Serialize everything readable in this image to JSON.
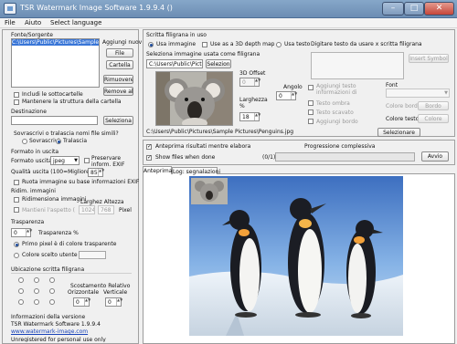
{
  "window": {
    "title": "TSR Watermark Image Software 1.9.9.4 ()",
    "minimize": "–",
    "maximize": "□",
    "close": "✕"
  },
  "menu": [
    "File",
    "Aiuto",
    "Select language"
  ],
  "left": {
    "source": {
      "title": "Fonte/Sorgente",
      "list": [
        "C:\\Users\\Public\\Pictures\\Sample Pictures"
      ],
      "add_label": "Aggiungi nuov",
      "file_btn": "File",
      "folder_btn": "Cartella",
      "remove_btn": "Rimuovere",
      "remove_all_btn": "Remove all",
      "include_subfolders": "Includi le sottocartelle",
      "keep_structure": "Mantenere la struttura della cartella"
    },
    "destination": {
      "title": "Destinazione",
      "value": "",
      "select_btn": "Seleziona"
    },
    "overwrite": {
      "question": "Sovrascrivi o tralascia nomi file simili?",
      "overwrite": "Sovrascrivi",
      "skip": "Tralascia"
    },
    "output": {
      "title": "Formato in uscita",
      "format_label": "Formato uscita",
      "format_value": "jpeg",
      "preserve_exif": "Preservare inform. EXIF",
      "quality_label": "Qualità uscita (100=Migliore)",
      "quality_value": "85",
      "rotate": "Ruota immagine su base informazioni EXIF"
    },
    "resize": {
      "title": "Ridim. immagini",
      "resize_images": "Ridimensiona immagini",
      "width_height": "Larghez Altezza",
      "keep_ratio": "Mantieni l'aspetto (rapp",
      "width": "1024",
      "height": "768",
      "pixel": "Pixel"
    },
    "transparency": {
      "title": "Trasparenza",
      "value": "0",
      "unit": "Trasparenza  %",
      "first_pixel": "Primo pixel è di colore trasparente",
      "user_color": "Colore scelto utente"
    },
    "position": {
      "title": "Ubicazione scritta filigrana",
      "relative_offset": "Scostamento Relativo",
      "horizontal": "Orizzontale",
      "vertical": "Verticale",
      "h_value": "0",
      "v_value": "0"
    },
    "version": {
      "title": "Informazioni della versione",
      "name": "TSR Watermark Software 1.9.9.4",
      "link": "www.watermark-image.com",
      "cut": "Unregistered for personal use only"
    }
  },
  "watermark": {
    "title": "Scritta filigrana in uso",
    "use_image": "Usa immagine",
    "use_3d": "Use as a 3D depth map",
    "use_text": "Usa testo",
    "text_prompt": "Digitare testo da usare x scritta filigrana",
    "select_image_label": "Seleziona immagine usata come filigrana",
    "path_value": "C:\\Users\\Public\\Pictures\\",
    "select_btn": "Selezion",
    "offset_label": "3D Offset",
    "offset_value": "0",
    "width_label": "Larghezza %",
    "width_value": "18",
    "angle_label": "Angolo",
    "angle_value": "0",
    "add_text_info": "Aggiungi testo informazioni di",
    "shadow_text": "Testo ombra",
    "cut_text": "Testo scavato",
    "add_border": "Aggiungi bordo",
    "insert_symbol": "Insert Symbol",
    "font_label": "Font",
    "border_color": "Colore bordo",
    "border_btn": "Bordo",
    "text_color": "Colore testo",
    "color_btn": "Colore",
    "select_btn2": "Selezionare",
    "file_path": "C:\\Users\\Public\\Pictures\\Sample Pictures\\Penguins.jpg"
  },
  "process": {
    "preview": "Anteprima risultati mentre elabora",
    "show_files": "Show files when done",
    "progress_label": "Progressione complessiva",
    "count": "(0/1)",
    "progress": 0,
    "start_btn": "Avvio"
  },
  "tabs": [
    "Anteprima",
    "Log: segnalazioni"
  ]
}
